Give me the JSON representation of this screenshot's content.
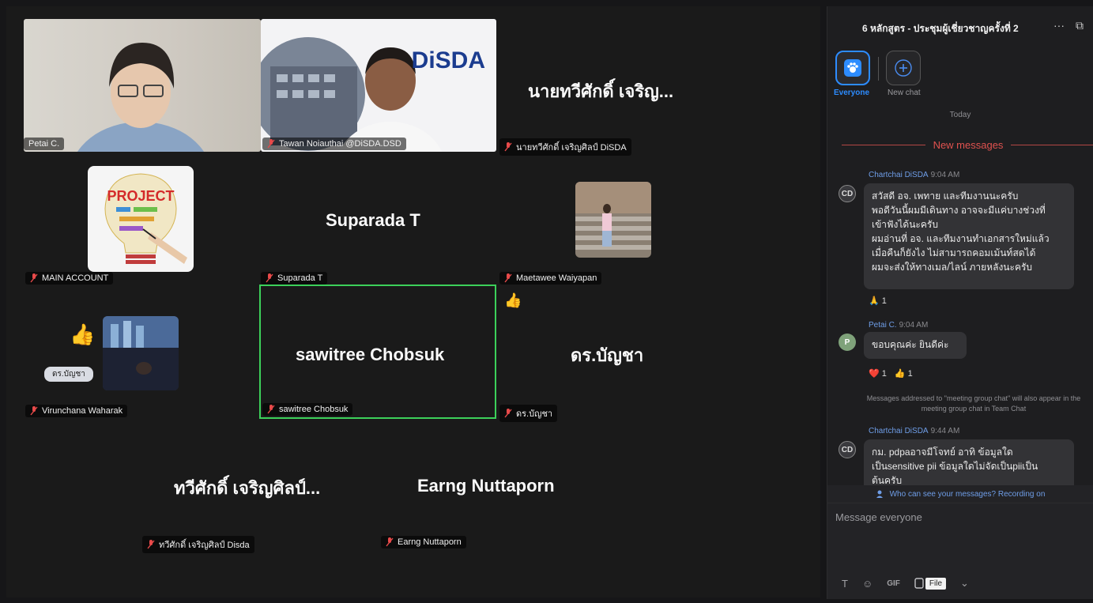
{
  "tiles": {
    "petai": {
      "name": "Petai C."
    },
    "tawan": {
      "name": "Tawan Noiauthai @DiSDA.DSD",
      "logo": "DiSDA"
    },
    "nai": {
      "big": "นายทวีศักดิ์ เจริญ...",
      "name": "นายทวีศักดิ์ เจริญศิลป์ DiSDA"
    },
    "main": {
      "name": "MAIN ACCOUNT",
      "project_word": "PROJECT"
    },
    "suparada": {
      "big": "Suparada T",
      "name": "Suparada T"
    },
    "maetawee": {
      "name": "Maetawee Waiyapan"
    },
    "virunchana": {
      "name": "Virunchana Waharak",
      "badge": "ดร.บัญชา"
    },
    "sawitree": {
      "big": "sawitree Chobsuk",
      "name": "sawitree Chobsuk"
    },
    "dr": {
      "big": "ดร.บัญชา",
      "name": "ดร.บัญชา"
    },
    "taweesak": {
      "big": "ทวีศักดิ์ เจริญศิลป์...",
      "name": "ทวีศักดิ์ เจริญศิลป์ Disda"
    },
    "earng": {
      "big": "Earng Nuttaporn",
      "name": "Earng Nuttaporn"
    }
  },
  "chat": {
    "title": "6 หลักสูตร - ประชุมผู้เชี่ยวชาญครั้งที่ 2",
    "more_icon": "···",
    "popout_icon": "⧉",
    "channels": [
      {
        "label": "Everyone",
        "icon": "paw-icon"
      },
      {
        "label": "New chat",
        "icon": "plus-icon"
      }
    ],
    "today": "Today",
    "new_messages": "New messages",
    "messages": [
      {
        "initials": "CD",
        "sender": "Chartchai DiSDA",
        "time": "9:04 AM",
        "lines": [
          "สวัสดี อจ. เพทาย และทีมงานนะครับ",
          "พอดีวันนี้ผมมีเดินทาง อาจจะมีแค่บางช่วงที่",
          "เข้าฟังได้นะครับ",
          "ผมอ่านที่ อจ. และทีมงานทำเอกสารใหม่แล้ว",
          "เมื่อคืนก็ยังไง ไม่สามารถคอมเม้นท์สดได้",
          "ผมจะส่งให้ทางเมล/ไลน์ ภายหลังนะครับ"
        ],
        "reactions": [
          "🙏 1"
        ]
      },
      {
        "initials": "P",
        "sender": "Petai C.",
        "time": "9:04 AM",
        "lines": [
          "ขอบคุณค่ะ ยินดีค่ะ"
        ],
        "reactions": [
          "❤️ 1",
          "👍 1"
        ]
      },
      {
        "initials": "CD",
        "sender": "Chartchai DiSDA",
        "time": "9:44 AM",
        "lines": [
          "กม. pdpaอาจมีโจทย์ อาทิ ข้อมูลใด",
          "เป็นsensitive pii ข้อมูลใดไม่จัดเป็นpiiเป็น",
          "ต้นครับ"
        ],
        "reactions": []
      }
    ],
    "system_note": "Messages addressed to \"meeting group chat\" will also appear in the meeting group chat in Team Chat",
    "recording_note": "Who can see your messages? Recording on",
    "composer_placeholder": "Message everyone",
    "toolbar": {
      "text": "T",
      "emoji": "☺",
      "gif": "GIF",
      "file_tooltip": "File",
      "more": "⌄"
    }
  },
  "colors": {
    "accent": "#2d8cff",
    "active_speaker": "#3cd05a",
    "new_messages": "#e0524f",
    "sender": "#6f9ee8"
  }
}
